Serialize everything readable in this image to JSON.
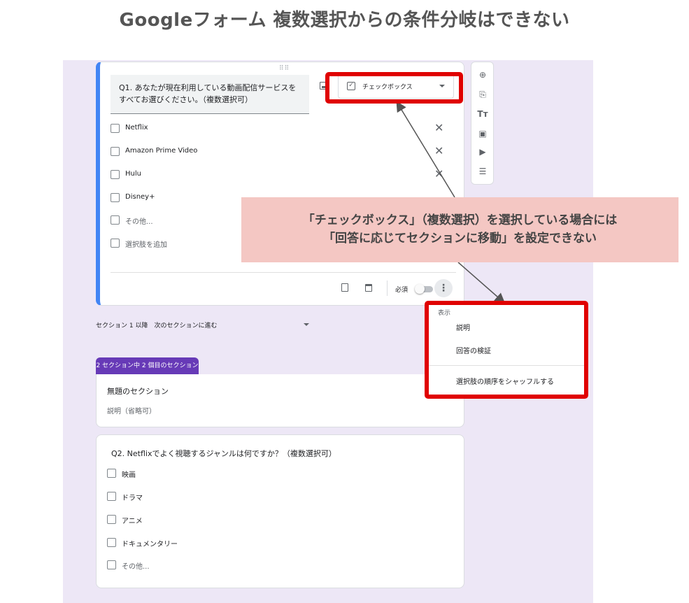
{
  "page_title": "Googleフォーム 複数選択からの条件分岐はできない",
  "q1": {
    "title": "Q1. あなたが現在利用している動画配信サービスをすべてお選びください。（複数選択可）",
    "type_label": "チェックボックス",
    "options": [
      "Netflix",
      "Amazon Prime Video",
      "Hulu",
      "Disney+"
    ],
    "other_label": "その他...",
    "add_option_label": "選択肢を追加",
    "required_label": "必須"
  },
  "callout": {
    "line1": "「チェックボックス」（複数選択）を選択している場合には",
    "line2": "「回答に応じてセクションに移動」を設定できない"
  },
  "menu": {
    "header": "表示",
    "items": [
      "説明",
      "回答の検証",
      "選択肢の順序をシャッフルする"
    ]
  },
  "section_nav": "セクション 1 以降　次のセクションに進む",
  "section2": {
    "tab_label": "2 セクション中 2 個目のセクション",
    "title": "無題のセクション",
    "description_placeholder": "説明（省略可）"
  },
  "q2": {
    "title": "Q2. Netflixでよく視聴するジャンルは何ですか？（複数選択可）",
    "options": [
      "映画",
      "ドラマ",
      "アニメ",
      "ドキュメンタリー"
    ],
    "other_label": "その他..."
  },
  "colors": {
    "accent_blue": "#4285f4",
    "purple": "#673ab7",
    "highlight_red": "#e00000",
    "callout_bg": "#f4c7c3"
  }
}
